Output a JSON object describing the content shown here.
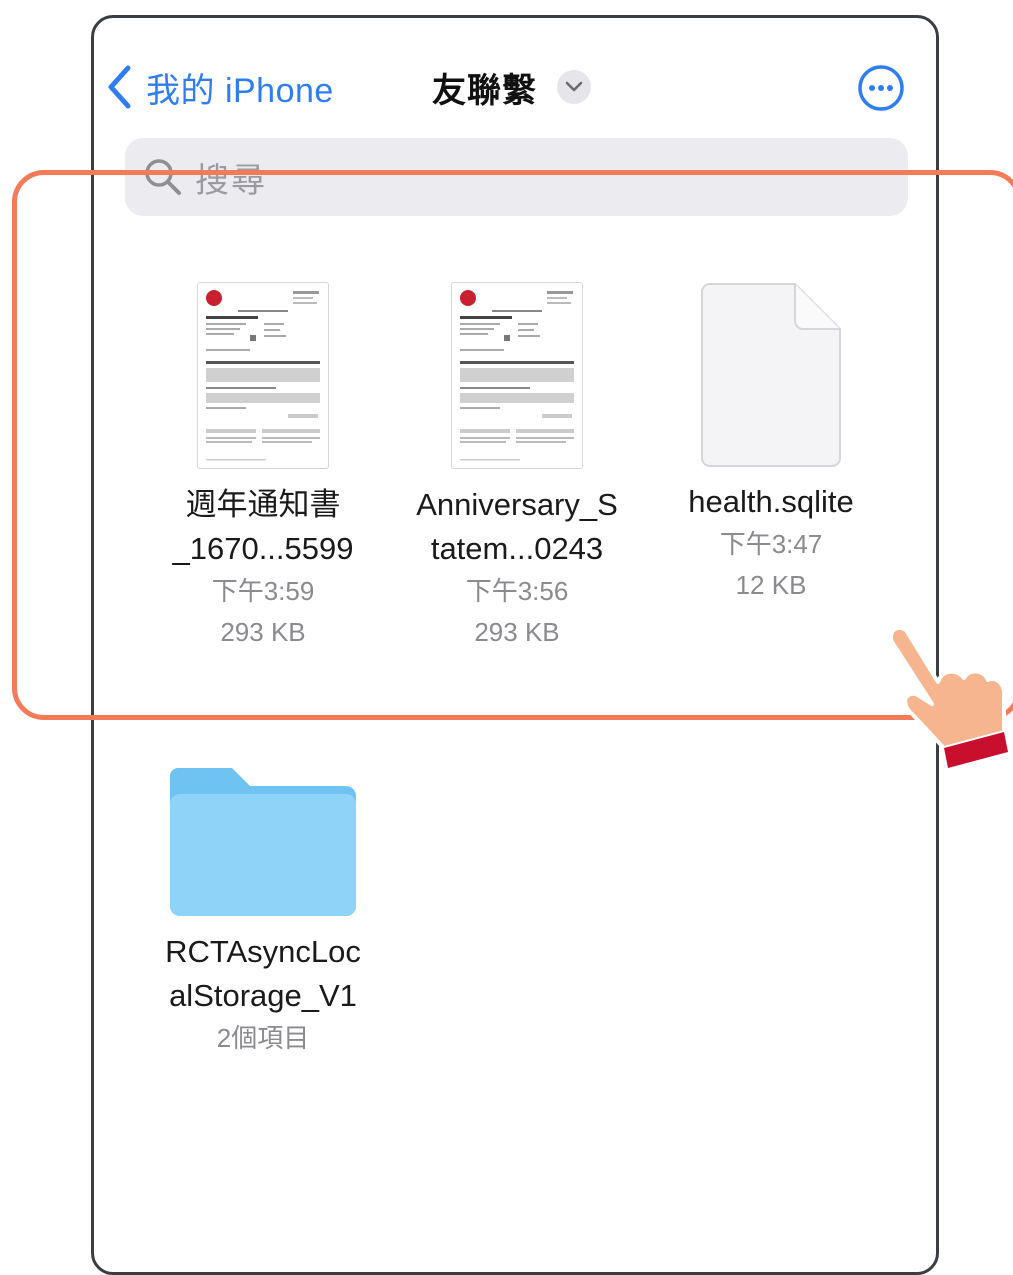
{
  "nav": {
    "back_label": "我的 iPhone",
    "title": "友聯繫"
  },
  "search": {
    "placeholder": "搜尋"
  },
  "files": [
    {
      "name_line1": "週年通知書",
      "name_line2": "_1670...5599",
      "time": "下午3:59",
      "size": "293 KB"
    },
    {
      "name_line1": "Anniversary_S",
      "name_line2": "tatem...0243",
      "time": "下午3:56",
      "size": "293 KB"
    },
    {
      "name_line1": "health.sqlite",
      "time": "下午3:47",
      "size": "12 KB"
    }
  ],
  "folder": {
    "name_line1": "RCTAsyncLoc",
    "name_line2": "alStorage_V1",
    "count": "2個項目"
  },
  "colors": {
    "accent": "#2f7ef0",
    "highlight": "#f47b57",
    "folder": "#8fd3f8"
  }
}
